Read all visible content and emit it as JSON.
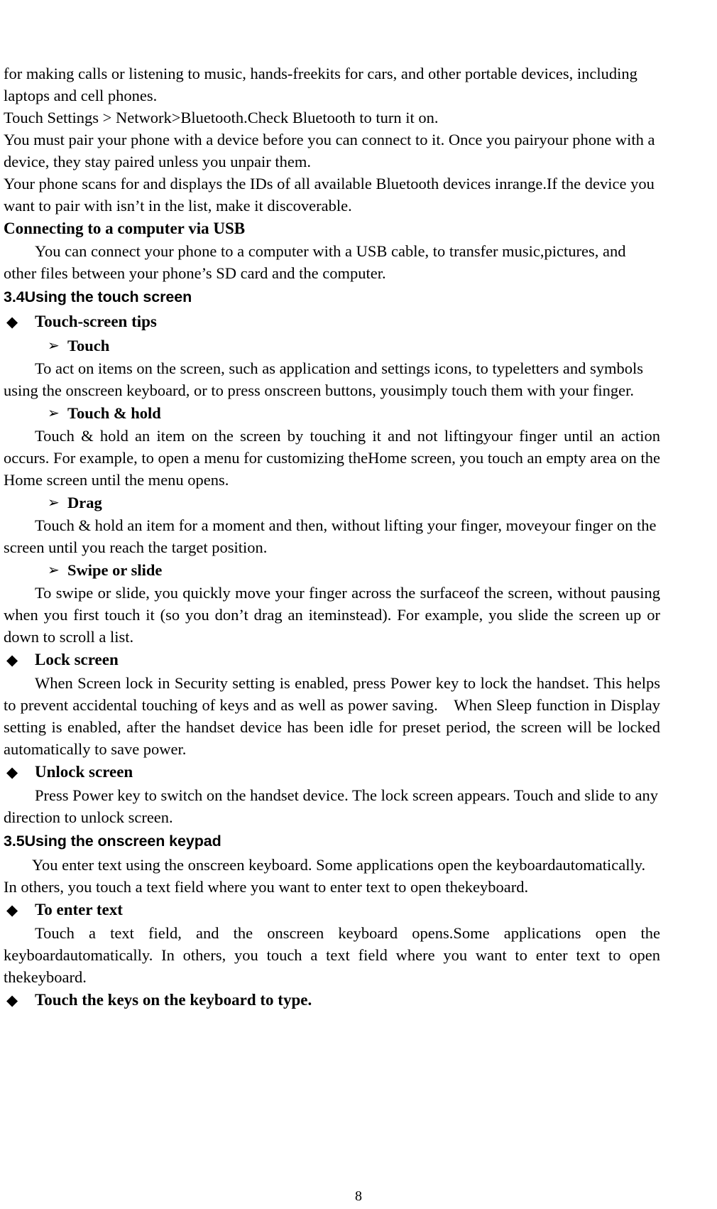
{
  "document": {
    "page_number": "8"
  },
  "bullets": {
    "level1": "◆",
    "level2": "➢"
  },
  "body": {
    "bluetooth_intro": "for making calls or listening to music, hands-freekits for cars, and other portable devices, including laptops and cell phones.",
    "bluetooth_settings": "Touch Settings > Network>Bluetooth.Check Bluetooth to turn it on.",
    "bluetooth_pair": "You must pair your phone with a device before you can connect to it. Once you pairyour phone with a device, they stay paired unless you unpair them.",
    "bluetooth_scan": "Your phone scans for and displays the IDs of all available Bluetooth devices inrange.If the device you want to pair with isn’t in the list, make it discoverable."
  },
  "usb_section": {
    "heading": "Connecting to a computer via USB",
    "paragraph": "You can connect your phone to a computer with a USB cable, to transfer music,pictures, and other files between your phone’s SD card and the computer."
  },
  "section_3_4": {
    "heading": "3.4Using the touch screen",
    "touch_screen_tips": {
      "label": "Touch-screen tips",
      "items": [
        {
          "label": "Touch",
          "text": "To act on items on the screen, such as application and settings icons, to typeletters and symbols using the onscreen keyboard, or to press onscreen buttons, yousimply touch them with your finger."
        },
        {
          "label": "Touch & hold",
          "text": "Touch & hold an item on the screen by touching it and not liftingyour finger until an action occurs. For example, to open a menu for customizing theHome screen, you touch an empty area on the Home screen until the menu opens."
        },
        {
          "label": "Drag",
          "text": "Touch & hold an item for a moment and then, without lifting your finger, moveyour finger on the screen until you reach the target position."
        },
        {
          "label": "Swipe or slide",
          "text": "To swipe or slide, you quickly move your finger across the surfaceof the screen, without pausing when you first touch it (so you don’t drag an iteminstead). For example, you slide the screen up or down to scroll a list."
        }
      ]
    },
    "lock_screen": {
      "label": "Lock screen",
      "text": "When Screen lock in Security setting is enabled, press Power key to lock the handset. This helps to prevent accidental touching of keys and as well as power saving. When Sleep function in Display setting is enabled, after the handset device has been idle for preset period, the screen will be locked automatically to save power."
    },
    "unlock_screen": {
      "label": "Unlock screen",
      "text": "Press Power key to switch on the handset device. The lock screen appears. Touch and slide to any direction to unlock screen."
    }
  },
  "section_3_5": {
    "heading": "3.5Using the onscreen keypad",
    "intro": "You enter text using the onscreen keyboard. Some applications open the keyboardautomatically. In others, you touch a text field where you want to enter text to open thekeyboard.",
    "to_enter_text": {
      "label": "To enter text",
      "text": "Touch a text field, and the onscreen keyboard opens.Some applications open the keyboardautomatically. In others, you touch a text field where you want to enter text to open thekeyboard."
    },
    "touch_keys": {
      "label": "Touch the keys on the keyboard to type."
    }
  }
}
